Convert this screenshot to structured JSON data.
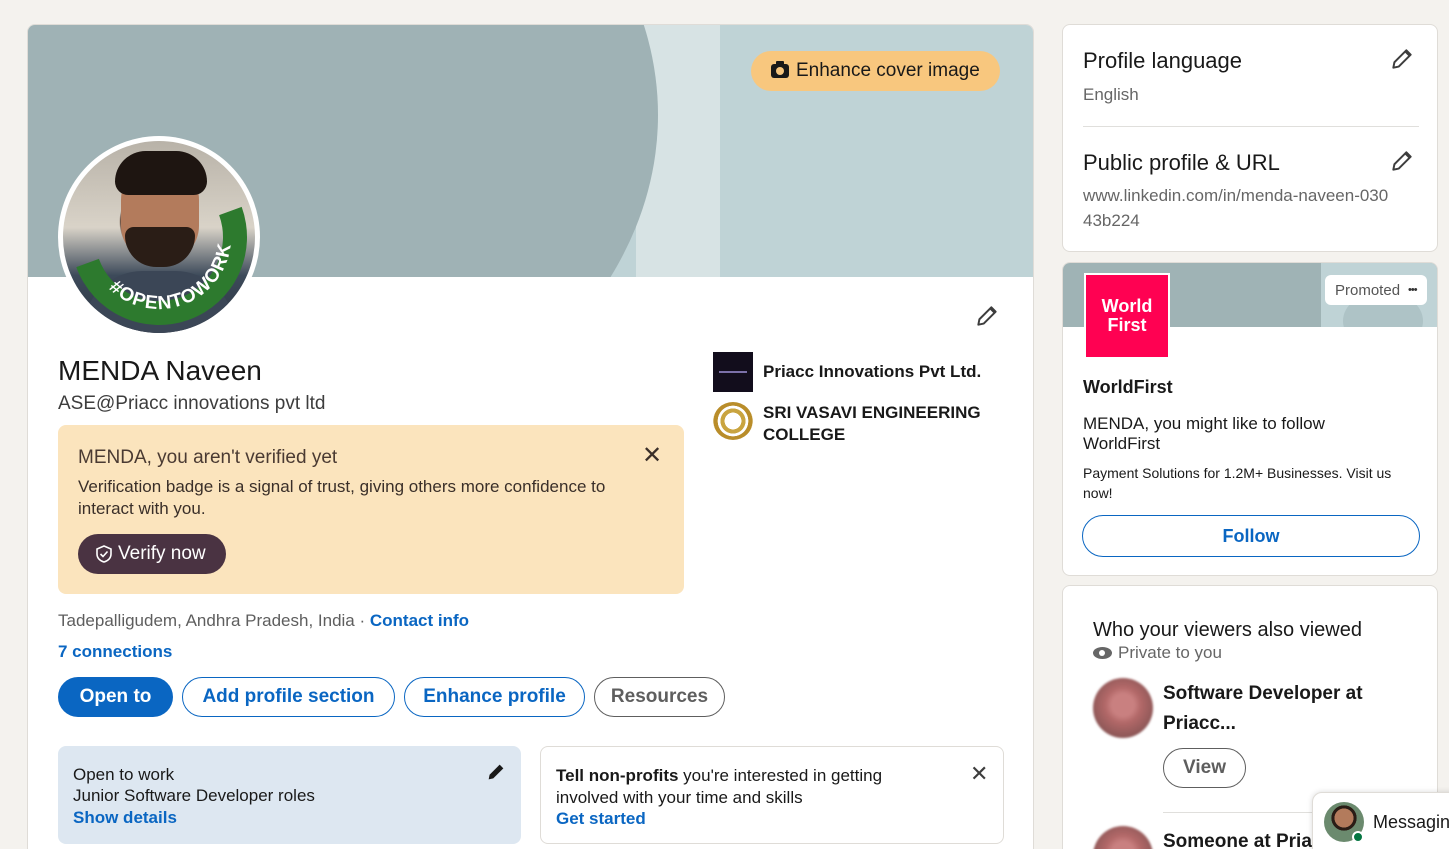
{
  "cover": {
    "enhance_label": "Enhance cover image"
  },
  "profile": {
    "name": "MENDA Naveen",
    "headline": "ASE@Priacc innovations pvt ltd",
    "open_to_work_badge": "#OPENTOWORK",
    "location": "Tadepalligudem, Andhra Pradesh, India",
    "location_sep": " · ",
    "contact_info": "Contact info",
    "connections": "7 connections"
  },
  "experience": [
    {
      "name": "Priacc Innovations Pvt Ltd."
    },
    {
      "name": "SRI VASAVI ENGINEERING COLLEGE"
    }
  ],
  "verification": {
    "title": "MENDA, you aren't verified yet",
    "text": "Verification badge is a signal of trust, giving others more confidence to interact with you.",
    "close": "✕",
    "button": "Verify now"
  },
  "actions": {
    "open_to": "Open to",
    "add_section": "Add profile section",
    "enhance": "Enhance profile",
    "resources": "Resources"
  },
  "open_to_work_card": {
    "title": "Open to work",
    "roles": "Junior Software Developer roles",
    "link": "Show details"
  },
  "nonprofit_card": {
    "bold": "Tell non-profits",
    "text": " you're interested in getting involved with your time and skills",
    "link": "Get started",
    "close": "✕"
  },
  "settings": {
    "language_title": "Profile language",
    "language_value": "English",
    "url_title": "Public profile & URL",
    "url_value": "www.linkedin.com/in/menda-naveen-03043b224"
  },
  "ad": {
    "promoted": "Promoted",
    "more": "•••",
    "logo_line1": "World",
    "logo_line2": "First",
    "company": "WorldFirst",
    "message": "MENDA, you might like to follow WorldFirst",
    "sub": "Payment Solutions for 1.2M+ Businesses. Visit us now!",
    "follow": "Follow",
    "brand_color": "#ff0152"
  },
  "viewers": {
    "title": "Who your viewers also viewed",
    "privacy": "Private to you",
    "people": [
      {
        "role": "Software Developer at Priacc...",
        "button": "View"
      },
      {
        "role": "Someone at Priacc"
      }
    ]
  },
  "messaging": {
    "label": "Messaging"
  },
  "colors": {
    "accent": "#0a66c2",
    "verify_bg": "#fbe4bd",
    "otw_green": "#2d7a2e"
  }
}
